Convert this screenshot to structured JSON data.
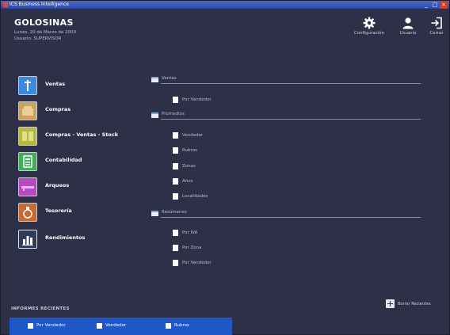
{
  "window": {
    "title": "ICS Business Intelligence",
    "controls": {
      "minimize": "_",
      "maximize": "□",
      "close": "×"
    }
  },
  "header": {
    "company": "GOLOSINAS",
    "date_line": "Lunes, 20 de Marzo de 2000",
    "user_line": "Usuario: SUPERVISOR"
  },
  "toolbar": [
    {
      "label": "Configuración",
      "icon": "gear-icon"
    },
    {
      "label": "Usuario",
      "icon": "user-icon"
    },
    {
      "label": "Cerrar",
      "icon": "exit-icon"
    }
  ],
  "menu": [
    {
      "label": "Ventas",
      "icon": "sales-icon",
      "color": "#3a8be0"
    },
    {
      "label": "Compras",
      "icon": "purchases-icon",
      "color": "#c9a25e"
    },
    {
      "label": "Compras - Ventas - Stock",
      "icon": "stock-icon",
      "color": "#b7b93c"
    },
    {
      "label": "Contabilidad",
      "icon": "accounting-icon",
      "color": "#3fae5a"
    },
    {
      "label": "Arqueos",
      "icon": "cash-count-icon",
      "color": "#b44bc0"
    },
    {
      "label": "Tesorería",
      "icon": "treasury-icon",
      "color": "#c66b33"
    },
    {
      "label": "Rendimientos",
      "icon": "performance-icon",
      "color": "#2f3a5c"
    }
  ],
  "groups": [
    {
      "title": "Ventas",
      "reports": [
        "Por Vendedor"
      ]
    },
    {
      "title": "Promedios",
      "reports": [
        "Vendedor",
        "Rubros",
        "Zonas",
        "Años",
        "Localidades"
      ]
    },
    {
      "title": "Resúmenes",
      "reports": [
        "Por IVA",
        "Por Zona",
        "Por Vendedor"
      ]
    }
  ],
  "recent": {
    "title": "INFORMES RECIENTES",
    "items": [
      "Por Vendedor",
      "Vendedor",
      "Rubros"
    ],
    "clear_label": "Borrar Recientes"
  },
  "colors": {
    "background": "#2d3046",
    "recent_bar": "#1f57c6"
  }
}
